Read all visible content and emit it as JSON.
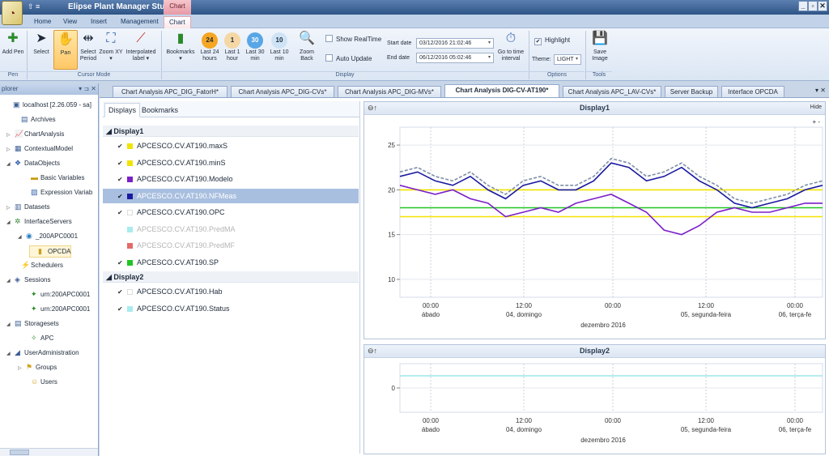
{
  "titlebar": {
    "title": "Elipse Plant Manager Studio",
    "context_tab": "Chart",
    "qat": "⇧ ≡",
    "controls": [
      "_",
      "▫",
      "✕"
    ]
  },
  "ribbon_tabs": [
    "Home",
    "View",
    "Insert",
    "Management",
    "Chart"
  ],
  "ribbon": {
    "add_pen": "Add Pen",
    "select": "Select",
    "pan": "Pan",
    "select_period": "Select Period",
    "zoom_xy": "Zoom XY ▾",
    "interpolated_label": "Interpolated label ▾",
    "bookmarks": "Bookmarks ▾",
    "last24": "Last 24 hours",
    "last1": "Last 1 hour",
    "last30": "Last 30 min",
    "last10": "Last 10 min",
    "last24_badge": "24",
    "last1_badge": "1",
    "last30_badge": "30",
    "last10_badge": "10",
    "zoom_back": "Zoom Back",
    "show_realtime": "Show RealTime",
    "auto_update": "Auto Update",
    "start_date_label": "Start date",
    "start_date": "03/12/2016 21:02:46",
    "end_date_label": "End date",
    "end_date": "06/12/2016 05:02:46",
    "go_to_time": "Go to time interval",
    "highlight": "Highlight",
    "theme_label": "Theme:",
    "theme": "LIGHT",
    "save_image": "Save Image",
    "groups": {
      "pen": "Pen",
      "cursor_mode": "Cursor Mode",
      "display": "Display",
      "options": "Options",
      "tools": "Tools"
    }
  },
  "explorer": {
    "title": "plorer",
    "controls": "▾ ⊐ ✕",
    "items": [
      {
        "label": "localhost [2.26.059 - sa]",
        "icon": "server-icon"
      },
      {
        "label": "Archives",
        "icon": "archive-icon"
      },
      {
        "label": "ChartAnalysis",
        "icon": "chart-icon"
      },
      {
        "label": "ContextualModel",
        "icon": "model-icon"
      },
      {
        "label": "DataObjects",
        "icon": "objects-icon"
      },
      {
        "label": "Basic Variables",
        "icon": "variable-icon"
      },
      {
        "label": "Expression Variab",
        "icon": "expression-icon"
      },
      {
        "label": "Datasets",
        "icon": "dataset-icon"
      },
      {
        "label": "InterfaceServers",
        "icon": "interface-icon"
      },
      {
        "label": "_200APC0001",
        "icon": "node-icon"
      },
      {
        "label": "OPCDA",
        "icon": "opc-icon"
      },
      {
        "label": "Schedulers",
        "icon": "scheduler-icon"
      },
      {
        "label": "Sessions",
        "icon": "session-icon"
      },
      {
        "label": "urn:200APC0001",
        "icon": "urn-icon"
      },
      {
        "label": "urn:200APC0001",
        "icon": "urn-icon"
      },
      {
        "label": "Storagesets",
        "icon": "storage-icon"
      },
      {
        "label": "APC",
        "icon": "apc-icon"
      },
      {
        "label": "UserAdministration",
        "icon": "users-admin-icon"
      },
      {
        "label": "Groups",
        "icon": "group-icon"
      },
      {
        "label": "Users",
        "icon": "user-icon"
      }
    ]
  },
  "doc_tabs": [
    "Chart Analysis APC_DIG_FatorH*",
    "Chart Analysis APC_DIG-CVs*",
    "Chart Analysis APC_DIG-MVs*",
    "Chart Analysis DIG-CV-AT190*",
    "Chart Analysis APC_LAV-CVs*",
    "Server Backup",
    "Interface OPCDA"
  ],
  "doc_tabs_ctl": "▾ ✕",
  "panel": {
    "tab_displays": "Displays",
    "tab_bookmarks": "Bookmarks",
    "groups": [
      {
        "name": "◢ Display1",
        "pens": [
          {
            "label": "APCESCO.CV.AT190.maxS",
            "color": "#f2e400",
            "checked": "✔"
          },
          {
            "label": "APCESCO.CV.AT190.minS",
            "color": "#f2e400",
            "checked": "✔"
          },
          {
            "label": "APCESCO.CV.AT190.Modelo",
            "color": "#7b1fc9",
            "checked": "✔"
          },
          {
            "label": "APCESCO.CV.AT190.NFMeas",
            "color": "#1a1aa0",
            "checked": "✔"
          },
          {
            "label": "APCESCO.CV.AT190.OPC",
            "color": "#ffffff",
            "checked": "✔"
          },
          {
            "label": "APCESCO.CV.AT190.PredMA",
            "color": "#a8ecee",
            "checked": ""
          },
          {
            "label": "APCESCO.CV.AT190.PredMF",
            "color": "#e46a6a",
            "checked": ""
          },
          {
            "label": "APCESCO.CV.AT190.SP",
            "color": "#22c422",
            "checked": "✔"
          }
        ]
      },
      {
        "name": "◢ Display2",
        "pens": [
          {
            "label": "APCESCO.CV.AT190.Hab",
            "color": "#ffffff",
            "checked": "✔"
          },
          {
            "label": "APCESCO.CV.AT190.Status",
            "color": "#a8ecee",
            "checked": "✔"
          }
        ]
      }
    ]
  },
  "display1": {
    "title": "Display1",
    "hide": "Hide",
    "zoomctl": "+ -"
  },
  "display2": {
    "title": "Display2"
  },
  "chart_data": [
    {
      "type": "line",
      "title": "Display1",
      "yticks": [
        "25",
        "20",
        "15",
        "10"
      ],
      "ylim": [
        8,
        27
      ],
      "xticks": [
        {
          "time": "00:00",
          "date": "ábado"
        },
        {
          "time": "12:00",
          "date": "04, domingo"
        },
        {
          "time": "00:00",
          "date": ""
        },
        {
          "time": "12:00",
          "date": "05, segunda-feira"
        },
        {
          "time": "00:00",
          "date": "06, terça-fe"
        }
      ],
      "xlabel": "dezembro 2016",
      "series": [
        {
          "color": "#f2e400",
          "values": [
            20,
            20,
            20,
            20,
            20,
            20,
            20,
            20,
            20,
            20,
            20,
            20,
            20,
            20,
            20,
            20,
            20,
            20,
            20,
            20,
            20,
            20,
            20,
            20,
            20
          ]
        },
        {
          "color": "#f2e400",
          "values": [
            17,
            17,
            17,
            17,
            17,
            17,
            17,
            17,
            17,
            17,
            17,
            17,
            17,
            17,
            17,
            17,
            17,
            17,
            17,
            17,
            17,
            17,
            17,
            17,
            17
          ]
        },
        {
          "color": "#22c422",
          "values": [
            18,
            18,
            18,
            18,
            18,
            18,
            18,
            18,
            18,
            18,
            18,
            18,
            18,
            18,
            18,
            18,
            18,
            18,
            18,
            18,
            18,
            18,
            18,
            18,
            18
          ]
        },
        {
          "color": "#7b1fc9",
          "values": [
            20.5,
            20,
            19.5,
            20,
            19,
            18.5,
            17,
            17.5,
            18,
            17.5,
            18.5,
            19,
            19.5,
            18.5,
            17.5,
            15.5,
            15,
            16,
            17.5,
            18,
            17.5,
            17.5,
            18,
            18.5,
            18.5
          ]
        },
        {
          "color": "#1a1aa0",
          "values": [
            21.5,
            22,
            21,
            20.5,
            21.5,
            20,
            19,
            20.5,
            21,
            20,
            20,
            21,
            23,
            22.5,
            21,
            21.5,
            22.5,
            21,
            20,
            18.5,
            18,
            18.5,
            19,
            20,
            20.5
          ]
        },
        {
          "color": "#7f8fa8",
          "values": [
            22,
            22.5,
            21.5,
            21,
            22,
            20.5,
            19.5,
            21,
            21.5,
            20.5,
            20.5,
            21.5,
            23.5,
            23,
            21.5,
            22,
            23,
            21.5,
            20.5,
            19,
            18.5,
            19,
            19.5,
            20.5,
            21
          ]
        }
      ]
    },
    {
      "type": "line",
      "title": "Display2",
      "yticks": [
        "0"
      ],
      "ylim": [
        -2,
        2
      ],
      "xticks": [
        {
          "time": "00:00",
          "date": "ábado"
        },
        {
          "time": "12:00",
          "date": "04, domingo"
        },
        {
          "time": "00:00",
          "date": ""
        },
        {
          "time": "12:00",
          "date": "05, segunda-feira"
        },
        {
          "time": "00:00",
          "date": "06, terça-fe"
        }
      ],
      "xlabel": "dezembro 2016",
      "series": [
        {
          "color": "#9fe6ea",
          "values": [
            1,
            1,
            1,
            1,
            1,
            1,
            1,
            1,
            1,
            1,
            1,
            1,
            1,
            1,
            1,
            1,
            1,
            1,
            1,
            1,
            1,
            1,
            1,
            1,
            1
          ]
        }
      ]
    }
  ]
}
